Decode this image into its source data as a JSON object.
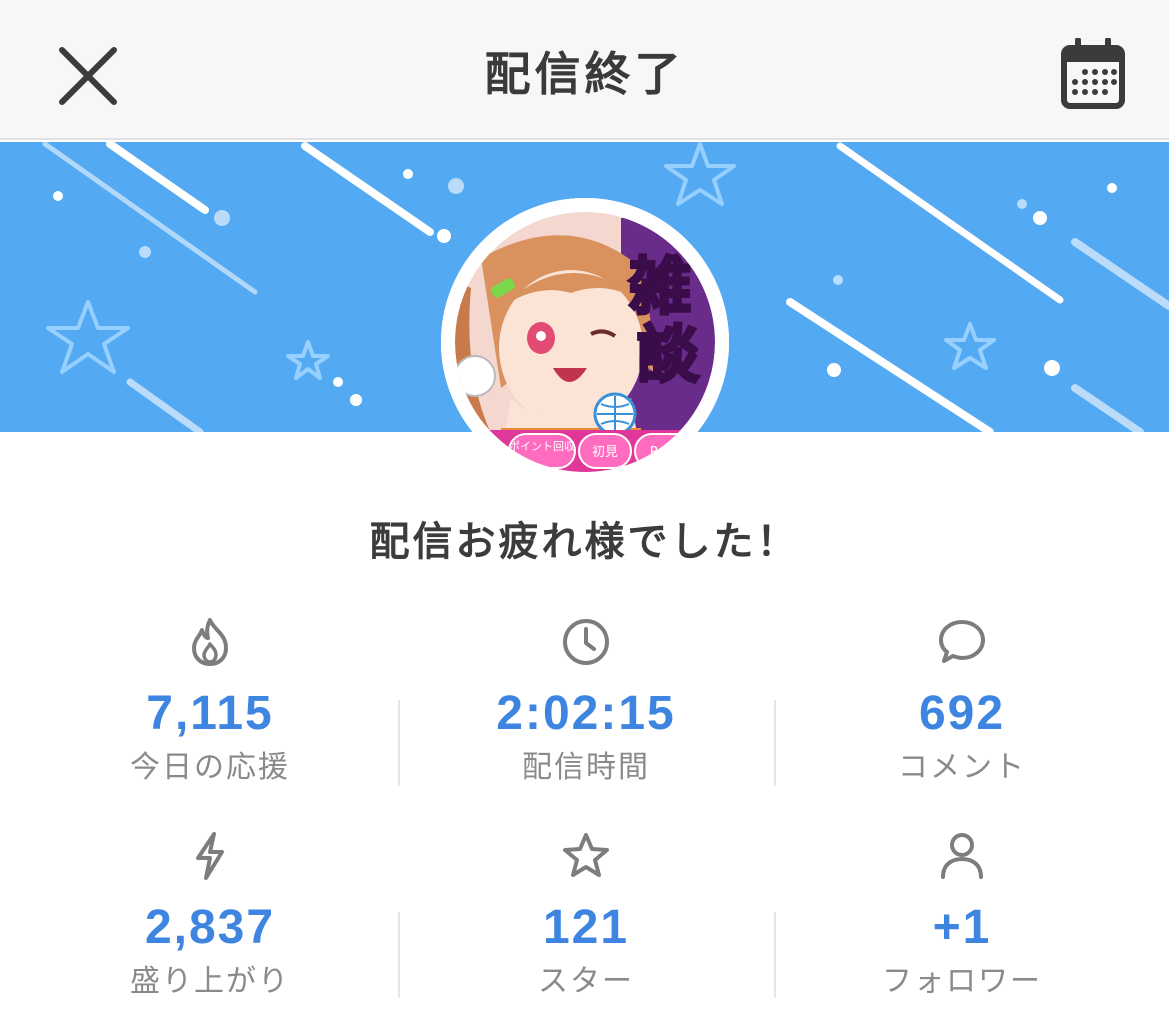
{
  "header": {
    "title": "配信終了",
    "close_icon": "close-icon",
    "calendar_icon": "calendar-icon"
  },
  "avatar": {
    "tags": [
      "ポイント回収",
      "初見",
      "ROM"
    ],
    "artwork_text": "雑談"
  },
  "message": "配信お疲れ様でした！",
  "stats": [
    {
      "icon": "flame-icon",
      "value": "7,115",
      "label": "今日の応援"
    },
    {
      "icon": "clock-icon",
      "value": "2:02:15",
      "label": "配信時間"
    },
    {
      "icon": "comment-icon",
      "value": "692",
      "label": "コメント"
    },
    {
      "icon": "lightning-icon",
      "value": "2,837",
      "label": "盛り上がり"
    },
    {
      "icon": "star-icon",
      "value": "121",
      "label": "スター"
    },
    {
      "icon": "person-icon",
      "value": "+1",
      "label": "フォロワー"
    }
  ],
  "colors": {
    "banner": "#54a9f3",
    "value": "#3d85e0",
    "label": "#8a8a8a",
    "title": "#3a3a3a"
  }
}
